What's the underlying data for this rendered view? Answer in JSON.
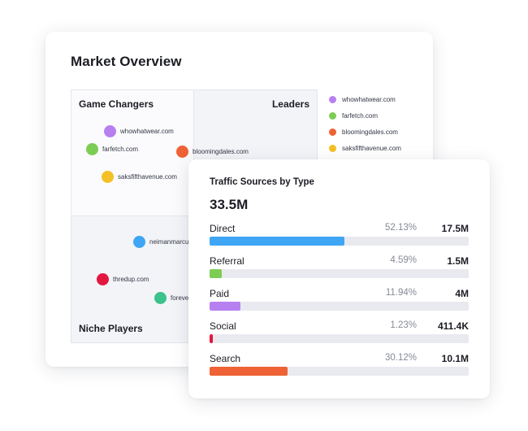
{
  "market_overview": {
    "title": "Market Overview",
    "quadrants": {
      "game_changers": "Game Changers",
      "leaders": "Leaders",
      "niche_players": "Niche Players"
    },
    "bubbles": [
      {
        "label": "whowhatwear.com",
        "color": "#b780f0"
      },
      {
        "label": "farfetch.com",
        "color": "#7ccd54"
      },
      {
        "label": "bloomingdales.com",
        "color": "#ee6235"
      },
      {
        "label": "saksfifthavenue.com",
        "color": "#f4c027"
      },
      {
        "label": "neimanmarcu",
        "color": "#3fa5f5"
      },
      {
        "label": "thredup.com",
        "color": "#e2173f"
      },
      {
        "label": "foreve",
        "color": "#3cc28c"
      }
    ],
    "legend": [
      {
        "label": "whowhatwear.com",
        "color": "#b780f0"
      },
      {
        "label": "farfetch.com",
        "color": "#7ccd54"
      },
      {
        "label": "bloomingdales.com",
        "color": "#ee6235"
      },
      {
        "label": "saksfifthavenue.com",
        "color": "#f4c027"
      }
    ]
  },
  "traffic_sources": {
    "title": "Traffic Sources by Type",
    "total": "33.5M",
    "rows": [
      {
        "name": "Direct",
        "pct": "52.13%",
        "value": "17.5M",
        "share": 0.5213,
        "color": "#3fa5f5"
      },
      {
        "name": "Referral",
        "pct": "4.59%",
        "value": "1.5M",
        "share": 0.0459,
        "color": "#7ccd54"
      },
      {
        "name": "Paid",
        "pct": "11.94%",
        "value": "4M",
        "share": 0.1194,
        "color": "#b780f0"
      },
      {
        "name": "Social",
        "pct": "1.23%",
        "value": "411.4K",
        "share": 0.0123,
        "color": "#e2173f"
      },
      {
        "name": "Search",
        "pct": "30.12%",
        "value": "10.1M",
        "share": 0.3012,
        "color": "#ee6235"
      }
    ]
  }
}
